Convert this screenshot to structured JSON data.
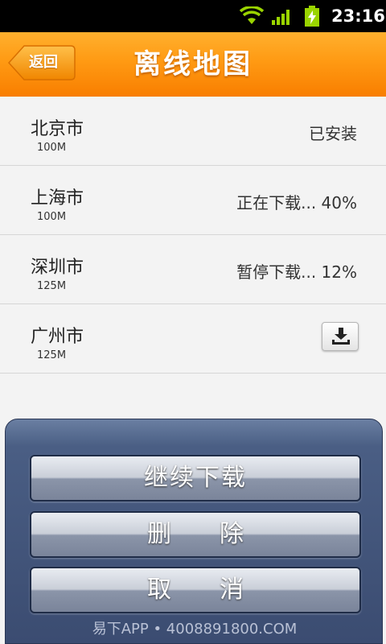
{
  "status_bar": {
    "time": "23:16",
    "icons": [
      "wifi-icon",
      "signal-icon",
      "battery-charging-icon"
    ]
  },
  "header": {
    "back_label": "返回",
    "title": "离线地图"
  },
  "cities": [
    {
      "name": "北京市",
      "size": "100M",
      "status": "已安装"
    },
    {
      "name": "上海市",
      "size": "100M",
      "status": "正在下载... 40%",
      "progress": 0.4
    },
    {
      "name": "深圳市",
      "size": "125M",
      "status": "暂停下载... 12%",
      "progress": 0.12
    },
    {
      "name": "广州市",
      "size": "125M",
      "action_icon": "download-icon"
    }
  ],
  "action_sheet": {
    "continue_label": "继续下载",
    "delete_label": "删　　除",
    "cancel_label": "取　　消"
  },
  "watermark": "易下APP • 4008891800.COM",
  "colors": {
    "header_orange": "#ff9a13",
    "sheet_blue": "#3b4c71",
    "list_bg": "#f3f3f3"
  }
}
